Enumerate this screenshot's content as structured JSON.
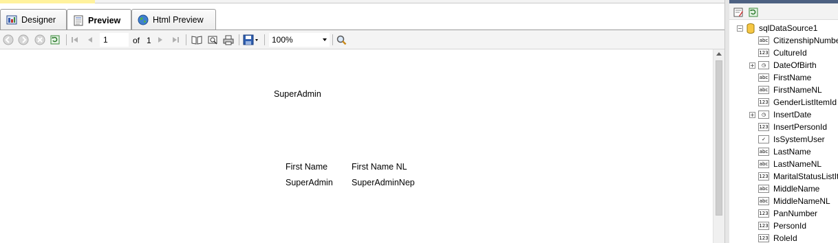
{
  "tabs": [
    {
      "label": "Designer",
      "icon": "designer-icon"
    },
    {
      "label": "Preview",
      "icon": "preview-icon",
      "active": true
    },
    {
      "label": "Html Preview",
      "icon": "globe-icon"
    }
  ],
  "toolbar": {
    "page_value": "1",
    "of_label": "of",
    "total_pages": "1",
    "zoom_value": "100%"
  },
  "report": {
    "header_user": "SuperAdmin",
    "columns": [
      "First Name",
      "First Name NL"
    ],
    "row": [
      "SuperAdmin",
      "SuperAdminNep"
    ]
  },
  "data_explorer": {
    "datasource": "sqlDataSource1",
    "fields": [
      {
        "name": "CitizenshipNumber",
        "type": "abc"
      },
      {
        "name": "CultureId",
        "type": "123"
      },
      {
        "name": "DateOfBirth",
        "type": "date",
        "expandable": true
      },
      {
        "name": "FirstName",
        "type": "abc"
      },
      {
        "name": "FirstNameNL",
        "type": "abc"
      },
      {
        "name": "GenderListItemId",
        "type": "123"
      },
      {
        "name": "InsertDate",
        "type": "date",
        "expandable": true
      },
      {
        "name": "InsertPersonId",
        "type": "123"
      },
      {
        "name": "IsSystemUser",
        "type": "bool"
      },
      {
        "name": "LastName",
        "type": "abc"
      },
      {
        "name": "LastNameNL",
        "type": "abc"
      },
      {
        "name": "MaritalStatusListItemId",
        "type": "123"
      },
      {
        "name": "MiddleName",
        "type": "abc"
      },
      {
        "name": "MiddleNameNL",
        "type": "abc"
      },
      {
        "name": "PanNumber",
        "type": "123"
      },
      {
        "name": "PersonId",
        "type": "123"
      },
      {
        "name": "RoleId",
        "type": "123"
      }
    ]
  },
  "colors": {
    "accent_yellow": "#fff29d",
    "panel_title": "#4d6182"
  }
}
